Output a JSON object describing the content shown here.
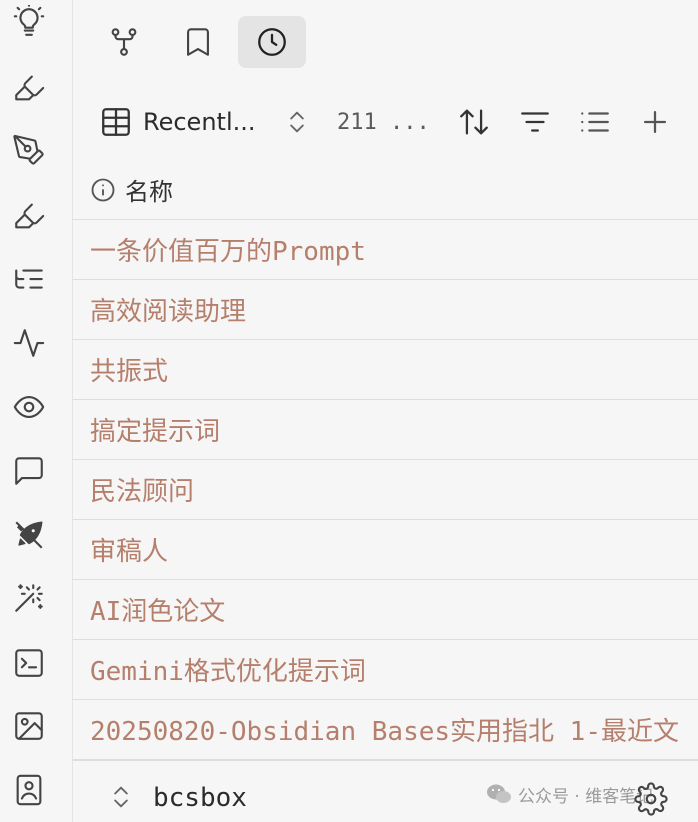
{
  "ribbon": {
    "icons": [
      "lightbulb-icon",
      "highlighter-icon",
      "pen-tool-icon",
      "highlighter-icon",
      "list-tree-icon",
      "activity-icon",
      "eye-icon",
      "message-square-icon",
      "rocket-icon",
      "magic-wand-icon",
      "terminal-icon",
      "image-icon",
      "image-frame-icon"
    ]
  },
  "tabs": {
    "items": [
      {
        "icon": "git-fork-icon"
      },
      {
        "icon": "bookmark-icon"
      },
      {
        "icon": "clock-icon",
        "active": true
      }
    ]
  },
  "toolbar": {
    "view_name": "Recentl...",
    "count": "211 ...",
    "icons": [
      "table-icon",
      "chevrons-up-down-icon",
      "sort-icon",
      "filter-icon",
      "list-icon",
      "plus-icon"
    ]
  },
  "table": {
    "header": "名称",
    "rows": [
      "一条价值百万的Prompt",
      "高效阅读助理",
      "共振式",
      "搞定提示词",
      "民法顾问",
      "审稿人",
      "AI润色论文",
      "Gemini格式优化提示词",
      "20250820-Obsidian Bases实用指北 1-最近文"
    ]
  },
  "footer": {
    "label": "bcsbox"
  },
  "watermark": {
    "text": "公众号 · 维客笔记"
  },
  "colors": {
    "link": "#b57f6c",
    "background": "#f6f6f6",
    "active_tab": "#e4e4e4"
  }
}
